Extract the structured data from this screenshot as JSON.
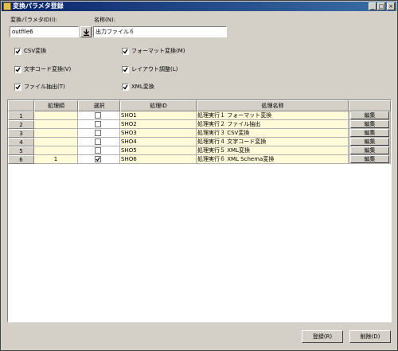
{
  "window": {
    "title": "変換パラメタ登録",
    "controls": [
      "_",
      "□",
      "×"
    ]
  },
  "form": {
    "param_id_label": "変換パラメタID(I):",
    "param_id_value": "outfile6",
    "name_label": "名称(N):",
    "name_value": "出力ファイル６"
  },
  "options": {
    "csv": {
      "label": "CSV変換",
      "checked": true
    },
    "format": {
      "label": "フォーマット変換(M)",
      "checked": true
    },
    "charcode": {
      "label": "文字コード変換(V)",
      "checked": true
    },
    "layout": {
      "label": "レイアウト調整(L)",
      "checked": true
    },
    "extract": {
      "label": "ファイル抽出(T)",
      "checked": true
    },
    "xml": {
      "label": "XML変換",
      "checked": true
    }
  },
  "table": {
    "headers": {
      "order": "処理順",
      "select": "選択",
      "proc_id": "処理ID",
      "proc_name": "処理名称",
      "edit": ""
    },
    "rows": [
      {
        "num": "1",
        "order": "",
        "selected": false,
        "proc_id": "SHO1",
        "proc_name": "処理実行１ フォーマット変換",
        "edit": "編集"
      },
      {
        "num": "2",
        "order": "",
        "selected": false,
        "proc_id": "SHO2",
        "proc_name": "処理実行２ ファイル抽出",
        "edit": "編集"
      },
      {
        "num": "3",
        "order": "",
        "selected": false,
        "proc_id": "SHO3",
        "proc_name": "処理実行３ CSV変換",
        "edit": "編集"
      },
      {
        "num": "4",
        "order": "",
        "selected": false,
        "proc_id": "SHO4",
        "proc_name": "処理実行４ 文字コード変換",
        "edit": "編集"
      },
      {
        "num": "5",
        "order": "",
        "selected": false,
        "proc_id": "SHO5",
        "proc_name": "処理実行５ XML変換",
        "edit": "編集"
      },
      {
        "num": "6",
        "order": "1",
        "selected": true,
        "proc_id": "SHO6",
        "proc_name": "処理実行６ XML Schema変換",
        "edit": "編集"
      }
    ]
  },
  "buttons": {
    "register": "登録(R)",
    "delete": "削除(D)"
  }
}
